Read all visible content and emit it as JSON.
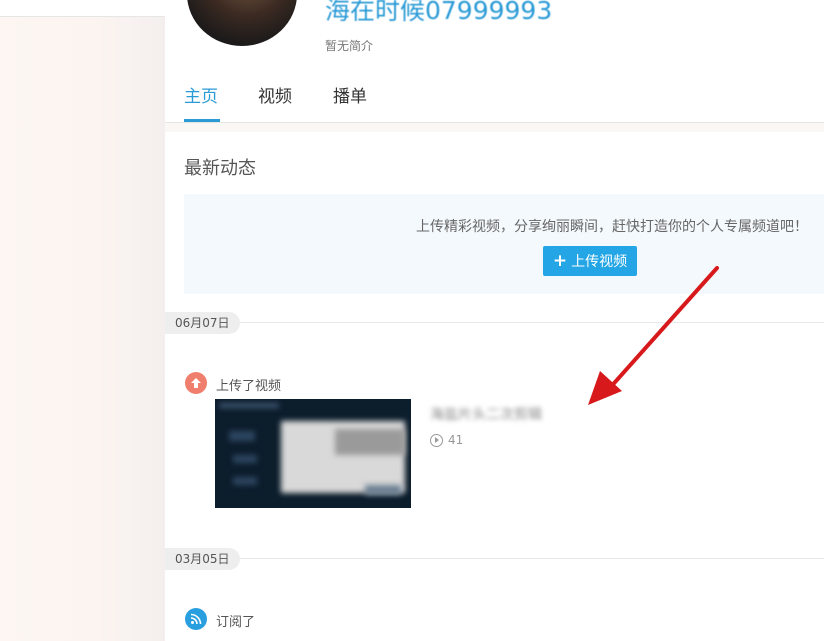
{
  "profile": {
    "username": "海在时候07999993",
    "intro": "暂无简介"
  },
  "tabs": [
    {
      "label": "主页",
      "active": true
    },
    {
      "label": "视频",
      "active": false
    },
    {
      "label": "播单",
      "active": false
    }
  ],
  "feed": {
    "section_title": "最新动态",
    "promo_text": "上传精彩视频，分享绚丽瞬间，赶快打造你的个人专属频道吧！",
    "upload_button": "上传视频",
    "groups": [
      {
        "date": "06月07日",
        "action": "上传了视频",
        "action_icon": "upload-icon",
        "video_title": "海盐片头二次剪辑",
        "plays": "41"
      },
      {
        "date": "03月05日",
        "action": "订阅了",
        "action_icon": "rss-icon"
      }
    ]
  },
  "colors": {
    "accent": "#2b9bd6",
    "button": "#23a5e6",
    "upload_icon": "#ef7f6c",
    "rss_icon": "#2a9fe0",
    "arrow": "#d7191c"
  }
}
